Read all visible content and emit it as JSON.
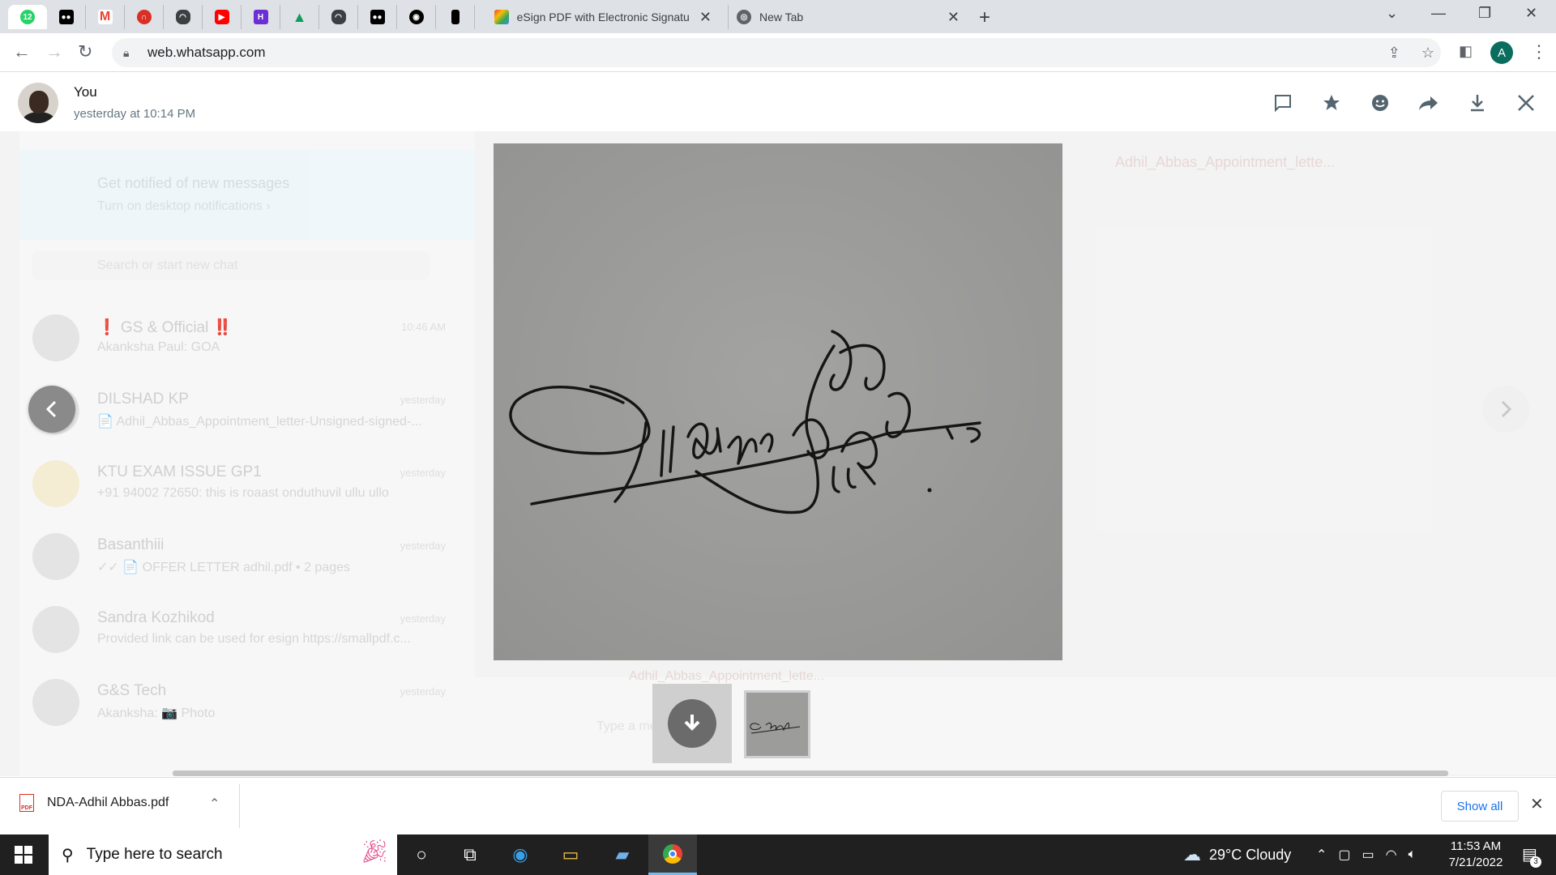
{
  "browser": {
    "pinned_tabs": [
      {
        "icon": "whatsapp-icon",
        "badge": "12",
        "color": "#25d366"
      },
      {
        "icon": "medium-icon",
        "color": "#000000"
      },
      {
        "icon": "gmail-icon",
        "color": "#ea4335"
      },
      {
        "icon": "castbox-icon",
        "color": "#d93025"
      },
      {
        "icon": "incognito-icon",
        "color": "#3c4043"
      },
      {
        "icon": "youtube-icon",
        "color": "#ff0000"
      },
      {
        "icon": "app-h-icon",
        "color": "#6b2fd3"
      },
      {
        "icon": "google-drive-icon",
        "color": "#0f9d58"
      },
      {
        "icon": "incognito-icon",
        "color": "#3c4043"
      },
      {
        "icon": "medium-icon",
        "color": "#000000"
      },
      {
        "icon": "github-icon",
        "color": "#000000"
      },
      {
        "icon": "phone-icon",
        "color": "#000000"
      }
    ],
    "tabs": [
      {
        "title": "eSign PDF with Electronic Signatu"
      },
      {
        "title": "New Tab"
      }
    ],
    "url": "web.whatsapp.com",
    "profile_initial": "A"
  },
  "viewer": {
    "sender_name": "You",
    "timestamp": "yesterday at 10:14 PM",
    "actions": [
      "reply-icon",
      "star-icon",
      "emoji-icon",
      "forward-icon",
      "download-icon",
      "close-icon"
    ]
  },
  "background_chats": {
    "notification_title": "Get notified of new messages",
    "notification_subtitle": "Turn on desktop notifications ›",
    "search_placeholder": "Search or start new chat",
    "right_header": "Adhil_Abbas_Appointment_lette...",
    "items": [
      {
        "name": "❗ GS & Official ‼️",
        "message": "Akanksha Paul: GOA",
        "time": "10:46 AM"
      },
      {
        "name": "DILSHAD KP",
        "message": "📄 Adhil_Abbas_Appointment_letter-Unsigned-signed-...",
        "time": "yesterday"
      },
      {
        "name": "KTU EXAM ISSUE GP1",
        "message": "+91 94002 72650: this is roaast onduthuvil ullu ullo",
        "time": "yesterday"
      },
      {
        "name": "Basanthiii",
        "message": "✓✓ 📄 OFFER LETTER adhil.pdf • 2 pages",
        "time": "yesterday"
      },
      {
        "name": "Sandra Kozhikod",
        "message": "Provided link can be used for esign https://smallpdf.c...",
        "time": "yesterday"
      },
      {
        "name": "G&S Tech",
        "message": "Akanksha: 📷 Photo",
        "time": "yesterday"
      }
    ],
    "footer_attachment": "Adhil_Abbas_Appointment_lette...",
    "footer_input_placeholder": "Type a message"
  },
  "downloads": {
    "file_name": "NDA-Adhil Abbas.pdf",
    "file_badge": "PDF",
    "show_all_label": "Show all"
  },
  "taskbar": {
    "search_placeholder": "Type here to search",
    "weather": "29°C  Cloudy",
    "time": "11:53 AM",
    "date": "7/21/2022",
    "notification_count": "3"
  }
}
